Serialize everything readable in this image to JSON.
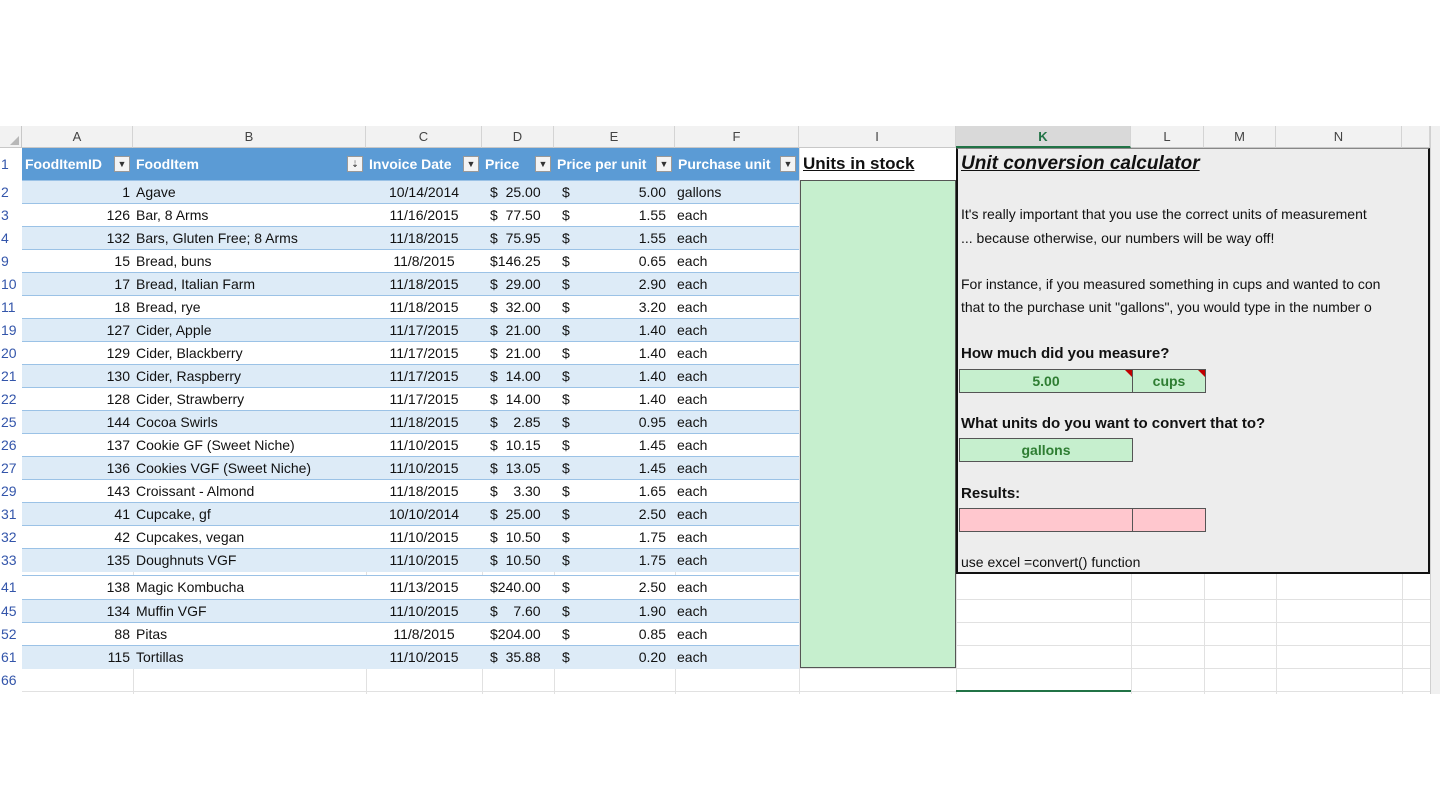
{
  "columns": [
    "A",
    "B",
    "C",
    "D",
    "E",
    "F",
    "I",
    "K",
    "L",
    "M",
    "N"
  ],
  "selected_column": "K",
  "row_numbers": [
    "1",
    "2",
    "3",
    "4",
    "9",
    "10",
    "11",
    "19",
    "20",
    "21",
    "22",
    "25",
    "26",
    "27",
    "29",
    "31",
    "32",
    "33",
    "41",
    "45",
    "52",
    "61",
    "66"
  ],
  "table": {
    "headers": [
      "FoodItemID",
      "FoodItem",
      "Invoice Date",
      "Price",
      "Price per unit",
      "Purchase unit"
    ],
    "rows": [
      {
        "id": "1",
        "item": "Agave",
        "date": "10/14/2014",
        "price": "$  25.00",
        "ppu_sym": "$",
        "ppu": "5.00",
        "unit": "gallons"
      },
      {
        "id": "126",
        "item": "Bar, 8 Arms",
        "date": "11/16/2015",
        "price": "$  77.50",
        "ppu_sym": "$",
        "ppu": "1.55",
        "unit": "each"
      },
      {
        "id": "132",
        "item": "Bars, Gluten Free; 8 Arms",
        "date": "11/18/2015",
        "price": "$  75.95",
        "ppu_sym": "$",
        "ppu": "1.55",
        "unit": "each"
      },
      {
        "id": "15",
        "item": "Bread, buns",
        "date": "11/8/2015",
        "price": "$146.25",
        "ppu_sym": "$",
        "ppu": "0.65",
        "unit": "each"
      },
      {
        "id": "17",
        "item": "Bread, Italian Farm",
        "date": "11/18/2015",
        "price": "$  29.00",
        "ppu_sym": "$",
        "ppu": "2.90",
        "unit": "each"
      },
      {
        "id": "18",
        "item": "Bread, rye",
        "date": "11/18/2015",
        "price": "$  32.00",
        "ppu_sym": "$",
        "ppu": "3.20",
        "unit": "each"
      },
      {
        "id": "127",
        "item": "Cider, Apple",
        "date": "11/17/2015",
        "price": "$  21.00",
        "ppu_sym": "$",
        "ppu": "1.40",
        "unit": "each"
      },
      {
        "id": "129",
        "item": "Cider, Blackberry",
        "date": "11/17/2015",
        "price": "$  21.00",
        "ppu_sym": "$",
        "ppu": "1.40",
        "unit": "each"
      },
      {
        "id": "130",
        "item": "Cider, Raspberry",
        "date": "11/17/2015",
        "price": "$  14.00",
        "ppu_sym": "$",
        "ppu": "1.40",
        "unit": "each"
      },
      {
        "id": "128",
        "item": "Cider, Strawberry",
        "date": "11/17/2015",
        "price": "$  14.00",
        "ppu_sym": "$",
        "ppu": "1.40",
        "unit": "each"
      },
      {
        "id": "144",
        "item": "Cocoa Swirls",
        "date": "11/18/2015",
        "price": "$    2.85",
        "ppu_sym": "$",
        "ppu": "0.95",
        "unit": "each"
      },
      {
        "id": "137",
        "item": "Cookie GF (Sweet Niche)",
        "date": "11/10/2015",
        "price": "$  10.15",
        "ppu_sym": "$",
        "ppu": "1.45",
        "unit": "each"
      },
      {
        "id": "136",
        "item": "Cookies VGF (Sweet Niche)",
        "date": "11/10/2015",
        "price": "$  13.05",
        "ppu_sym": "$",
        "ppu": "1.45",
        "unit": "each"
      },
      {
        "id": "143",
        "item": "Croissant - Almond",
        "date": "11/18/2015",
        "price": "$    3.30",
        "ppu_sym": "$",
        "ppu": "1.65",
        "unit": "each"
      },
      {
        "id": "41",
        "item": "Cupcake, gf",
        "date": "10/10/2014",
        "price": "$  25.00",
        "ppu_sym": "$",
        "ppu": "2.50",
        "unit": "each"
      },
      {
        "id": "42",
        "item": "Cupcakes, vegan",
        "date": "11/10/2015",
        "price": "$  10.50",
        "ppu_sym": "$",
        "ppu": "1.75",
        "unit": "each"
      },
      {
        "id": "135",
        "item": "Doughnuts VGF",
        "date": "11/10/2015",
        "price": "$  10.50",
        "ppu_sym": "$",
        "ppu": "1.75",
        "unit": "each"
      },
      {
        "id": "138",
        "item": "Magic Kombucha",
        "date": "11/13/2015",
        "price": "$240.00",
        "ppu_sym": "$",
        "ppu": "2.50",
        "unit": "each"
      },
      {
        "id": "134",
        "item": "Muffin VGF",
        "date": "11/10/2015",
        "price": "$    7.60",
        "ppu_sym": "$",
        "ppu": "1.90",
        "unit": "each"
      },
      {
        "id": "88",
        "item": "Pitas",
        "date": "11/8/2015",
        "price": "$204.00",
        "ppu_sym": "$",
        "ppu": "0.85",
        "unit": "each"
      },
      {
        "id": "115",
        "item": "Tortillas",
        "date": "11/10/2015",
        "price": "$  35.88",
        "ppu_sym": "$",
        "ppu": "0.20",
        "unit": "each"
      }
    ]
  },
  "units_in_stock_label": "Units in stock",
  "calculator": {
    "title": "Unit conversion calculator",
    "para1_line1": "It's really important that you use the correct units of measurement",
    "para1_line2": "... because otherwise, our numbers will be way off!",
    "para2_line1": "For instance, if you measured something in cups and wanted to con",
    "para2_line2": "that to the purchase unit \"gallons\", you would type in the number o",
    "q1": "How much did you measure?",
    "measure_value": "5.00",
    "measure_unit": "cups",
    "q2": "What units do you want to convert that to?",
    "target_unit": "gallons",
    "results_label": "Results:",
    "note": "use excel =convert() function"
  },
  "colors": {
    "header_blue": "#5b9bd5",
    "band_blue": "#ddebf7",
    "input_green": "#c6efce",
    "result_pink": "#ffc7ce",
    "accent": "#217346"
  }
}
